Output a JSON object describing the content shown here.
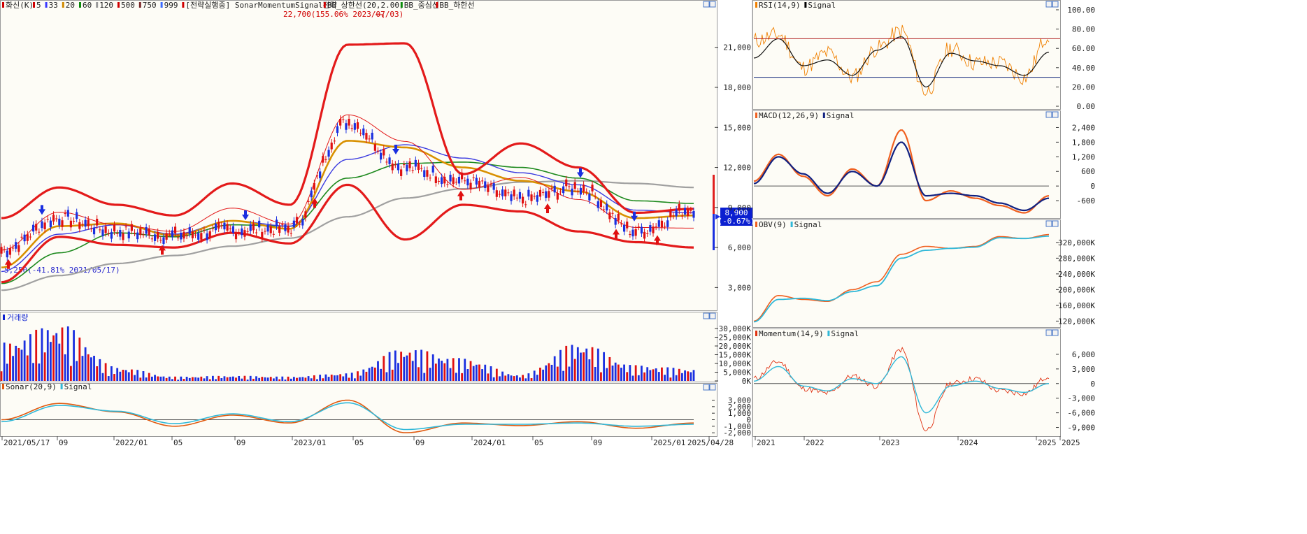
{
  "main_legend": [
    {
      "text": "화신(K)",
      "color": "#d00000"
    },
    {
      "text": "5",
      "color": "#d00000"
    },
    {
      "text": "33",
      "color": "#3a3aff"
    },
    {
      "text": "20",
      "color": "#d08a00"
    },
    {
      "text": "60",
      "color": "#0a8a0a"
    },
    {
      "text": "120",
      "color": "#999999"
    },
    {
      "text": "500",
      "color": "#d00000"
    },
    {
      "text": "750",
      "color": "#7a2a2a"
    },
    {
      "text": "999",
      "color": "#3a6aff"
    },
    {
      "text": "[전략실행중] SonarMomentumSignal전략",
      "color": "#d00000"
    },
    {
      "text": "BB_상한선(20,2.00)",
      "color": "#d00000"
    },
    {
      "text": "BB_중심선",
      "color": "#0a8a0a"
    },
    {
      "text": "BB_하한선",
      "color": "#d00000"
    }
  ],
  "annotations": {
    "high": "22,700(155.06% 2023/07/03)",
    "low": "5,250(-41.81% 2021/05/17)"
  },
  "price": {
    "value": "8,900",
    "change": "(-0.67%)"
  },
  "x_ticks": [
    "2021/05/17",
    "09",
    "2022/01",
    "05",
    "09",
    "2023/01",
    "05",
    "09",
    "2024/01",
    "05",
    "09",
    "2025/01",
    "2025/04/28"
  ],
  "right_x_ticks": [
    "2021",
    "2022",
    "2023",
    "2024",
    "2025",
    "2025"
  ],
  "volume_label": "거래량",
  "sonar_legend": [
    {
      "text": "Sonar(20,9)",
      "color": "#e05a10"
    },
    {
      "text": "Signal",
      "color": "#30b8d8"
    }
  ],
  "rsi_legend": [
    {
      "text": "RSI(14,9)",
      "color": "#f08000"
    },
    {
      "text": "Signal",
      "color": "#000000"
    }
  ],
  "macd_legend": [
    {
      "text": "MACD(12,26,9)",
      "color": "#f06020"
    },
    {
      "text": "Signal",
      "color": "#102080"
    }
  ],
  "obv_legend": [
    {
      "text": "OBV(9)",
      "color": "#f06020"
    },
    {
      "text": "Signal",
      "color": "#30b8d8"
    }
  ],
  "momentum_legend": [
    {
      "text": "Momentum(14,9)",
      "color": "#e03010"
    },
    {
      "text": "Signal",
      "color": "#30b8d8"
    }
  ],
  "chart_data": [
    {
      "type": "candlestick",
      "title": "화신(K)",
      "y_ticks": [
        "21,000",
        "18,000",
        "15,000",
        "12,000",
        "9,000",
        "6,000",
        "3,000"
      ],
      "ylim": [
        1500,
        23500
      ],
      "x": [
        "2021/05/17",
        "09",
        "2022/01",
        "05",
        "09",
        "2023/01",
        "05",
        "09",
        "2024/01",
        "05",
        "09",
        "2025/01",
        "2025/04/28"
      ],
      "close": [
        5800,
        8200,
        7200,
        6900,
        7300,
        7400,
        15400,
        12000,
        11000,
        9600,
        10500,
        7200,
        8900
      ],
      "bb_upper": [
        8200,
        10500,
        9200,
        8400,
        10800,
        9200,
        21200,
        21300,
        11500,
        13800,
        12000,
        8600,
        8900
      ],
      "bb_lower": [
        3400,
        6800,
        6200,
        6000,
        7100,
        6300,
        10700,
        6600,
        9200,
        8700,
        7200,
        6400,
        6000
      ],
      "last": 8900,
      "last_change_pct": -0.67
    },
    {
      "type": "bar",
      "title": "거래량",
      "y_ticks": [
        "30,000K",
        "25,000K",
        "20,000K",
        "15,000K",
        "10,000K",
        "5,000K",
        "0K"
      ],
      "ylim": [
        0,
        30000
      ],
      "x": [
        "2021/05",
        "2021/05",
        "09",
        "2022/01",
        "05",
        "09",
        "2023/01",
        "05",
        "09",
        "2024/01",
        "05",
        "09",
        "2025/01"
      ],
      "values": [
        22000,
        33000,
        8000,
        2500,
        3000,
        2500,
        4500,
        19000,
        13000,
        3500,
        22000,
        9000,
        7000
      ]
    },
    {
      "type": "line",
      "title": "Sonar(20,9)",
      "y_ticks": [
        "3,000",
        "2,000",
        "1,000",
        "0",
        "-1,000",
        "-2,000"
      ],
      "ylim": [
        -2300,
        3800
      ],
      "series": [
        {
          "name": "Sonar",
          "values": [
            0,
            2500,
            1200,
            -1000,
            700,
            -500,
            3000,
            -2000,
            -500,
            -900,
            -300,
            -1300,
            -500
          ]
        },
        {
          "name": "Signal",
          "values": [
            -300,
            2200,
            1300,
            -600,
            900,
            -300,
            2600,
            -1500,
            -700,
            -700,
            -500,
            -1000,
            -700
          ]
        }
      ]
    },
    {
      "type": "line",
      "title": "RSI(14,9)",
      "y_ticks": [
        "100.00",
        "80.00",
        "60.00",
        "40.00",
        "20.00",
        "0.00"
      ],
      "ylim": [
        0,
        100
      ],
      "series": [
        {
          "name": "RSI",
          "values": [
            68,
            74,
            40,
            55,
            30,
            60,
            78,
            15,
            60,
            45,
            45,
            30,
            74
          ]
        },
        {
          "name": "Signal",
          "values": [
            50,
            70,
            42,
            48,
            32,
            58,
            72,
            20,
            55,
            47,
            42,
            32,
            56
          ]
        }
      ]
    },
    {
      "type": "line",
      "title": "MACD(12,26,9)",
      "y_ticks": [
        "2,400",
        "1,800",
        "1,200",
        "600",
        "0",
        "-600"
      ],
      "ylim": [
        -1200,
        2700
      ],
      "series": [
        {
          "name": "MACD",
          "values": [
            200,
            1300,
            400,
            -400,
            700,
            0,
            2300,
            -600,
            -200,
            -500,
            -800,
            -1100,
            -400
          ]
        },
        {
          "name": "Signal",
          "values": [
            100,
            1200,
            500,
            -300,
            600,
            0,
            1800,
            -400,
            -300,
            -400,
            -700,
            -1000,
            -500
          ]
        }
      ]
    },
    {
      "type": "line",
      "title": "OBV(9)",
      "y_ticks": [
        "320,000K",
        "280,000K",
        "240,000K",
        "200,000K",
        "160,000K",
        "120,000K"
      ],
      "ylim": [
        110000,
        350000
      ],
      "series": [
        {
          "name": "OBV",
          "values": [
            120000,
            185000,
            175000,
            170000,
            200000,
            220000,
            290000,
            310000,
            305000,
            310000,
            335000,
            330000,
            340000
          ]
        },
        {
          "name": "Signal",
          "values": [
            118000,
            175000,
            178000,
            172000,
            195000,
            210000,
            280000,
            300000,
            305000,
            308000,
            332000,
            330000,
            336000
          ]
        }
      ]
    },
    {
      "type": "line",
      "title": "Momentum(14,9)",
      "y_ticks": [
        "6,000",
        "3,000",
        "0",
        "-3,000",
        "-6,000",
        "-9,000"
      ],
      "ylim": [
        -10500,
        9000
      ],
      "series": [
        {
          "name": "Momentum",
          "values": [
            1000,
            4500,
            -1000,
            -2000,
            1500,
            -500,
            7000,
            -9500,
            0,
            1000,
            -1500,
            -2000,
            1500
          ]
        },
        {
          "name": "Signal",
          "values": [
            500,
            3500,
            -500,
            -1500,
            1000,
            0,
            5500,
            -6000,
            -500,
            500,
            -1000,
            -1800,
            0
          ]
        }
      ]
    }
  ]
}
